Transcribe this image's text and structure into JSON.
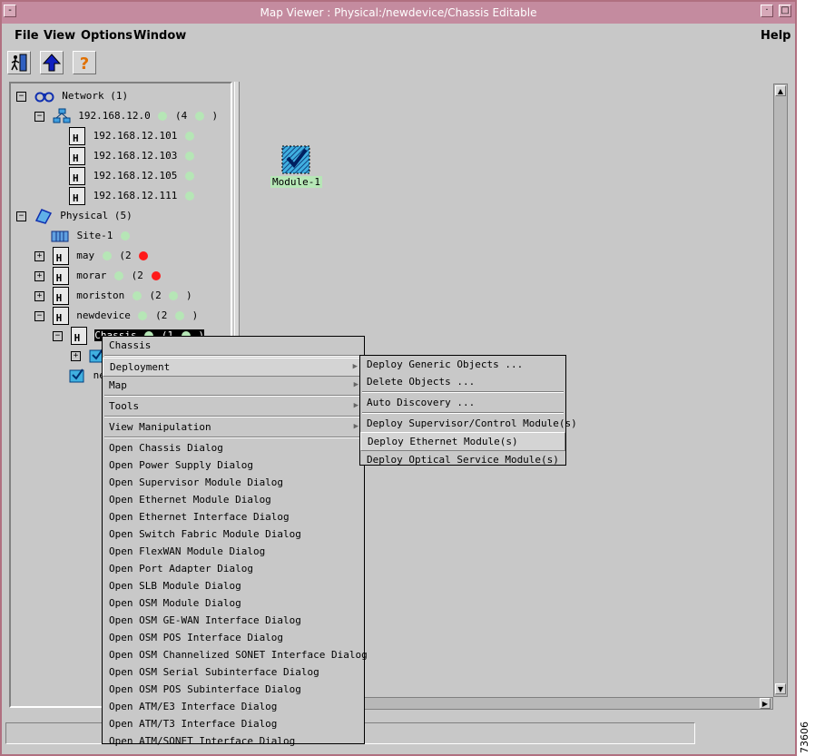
{
  "window": {
    "title": "Map Viewer : Physical:/newdevice/Chassis    Editable"
  },
  "menubar": {
    "file": "File",
    "view": "View",
    "options": "Options",
    "window": "Window",
    "help": "Help"
  },
  "tree": {
    "network": {
      "label": "Network (1)"
    },
    "subnet": {
      "label": "192.168.12.0",
      "count": "(4",
      "close": ")"
    },
    "hosts": [
      "192.168.12.101",
      "192.168.12.103",
      "192.168.12.105",
      "192.168.12.111"
    ],
    "physical": {
      "label": "Physical (5)"
    },
    "site": "Site-1",
    "may": {
      "label": "may",
      "count": "(2"
    },
    "morar": {
      "label": "morar",
      "count": "(2"
    },
    "moriston": {
      "label": "moriston",
      "count": "(2",
      "close": ")"
    },
    "newdevice": {
      "label": "newdevice",
      "count": "(2",
      "close": ")"
    },
    "chassis": {
      "label": "Chassis",
      "count": "(1",
      "close": ")"
    },
    "new_partial": "new"
  },
  "canvas": {
    "module_label": "Module-1"
  },
  "context_menu": {
    "header": "Chassis",
    "deployment": "Deployment",
    "map": "Map",
    "tools": "Tools",
    "view_manipulation": "View Manipulation",
    "dialogs": [
      "Open Chassis Dialog",
      "Open Power Supply Dialog",
      "Open Supervisor Module Dialog",
      "Open Ethernet Module Dialog",
      "Open Ethernet Interface Dialog",
      "Open Switch Fabric Module Dialog",
      "Open FlexWAN Module Dialog",
      "Open Port Adapter Dialog",
      "Open SLB Module Dialog",
      "Open OSM Module Dialog",
      "Open OSM GE-WAN Interface Dialog",
      "Open OSM POS Interface Dialog",
      "Open OSM Channelized SONET Interface Dialog",
      "Open OSM Serial Subinterface Dialog",
      "Open OSM POS Subinterface Dialog",
      "Open ATM/E3 Interface Dialog",
      "Open ATM/T3 Interface Dialog",
      "Open ATM/SONET Interface Dialog"
    ]
  },
  "submenu": {
    "deploy_generic": "Deploy Generic Objects ...",
    "delete_objects": "Delete Objects ...",
    "auto_discovery": "Auto Discovery ...",
    "deploy_supervisor": "Deploy Supervisor/Control Module(s)",
    "deploy_ethernet": "Deploy Ethernet Module(s)",
    "deploy_optical": "Deploy Optical Service Module(s)"
  },
  "watermark": "73606",
  "icons": {
    "exit": "exit-door-icon",
    "up": "up-arrow-icon",
    "help": "help-question-icon",
    "network": "binoculars-icon",
    "subnet": "subnet-icon",
    "device": "device-icon",
    "physical": "physical-icon",
    "site": "site-icon",
    "module": "module-icon"
  },
  "colors": {
    "titlebar": "#c48b9f",
    "status_ok": "#b6e6b6",
    "status_alarm": "#ff1a1a",
    "selection": "#000000"
  }
}
